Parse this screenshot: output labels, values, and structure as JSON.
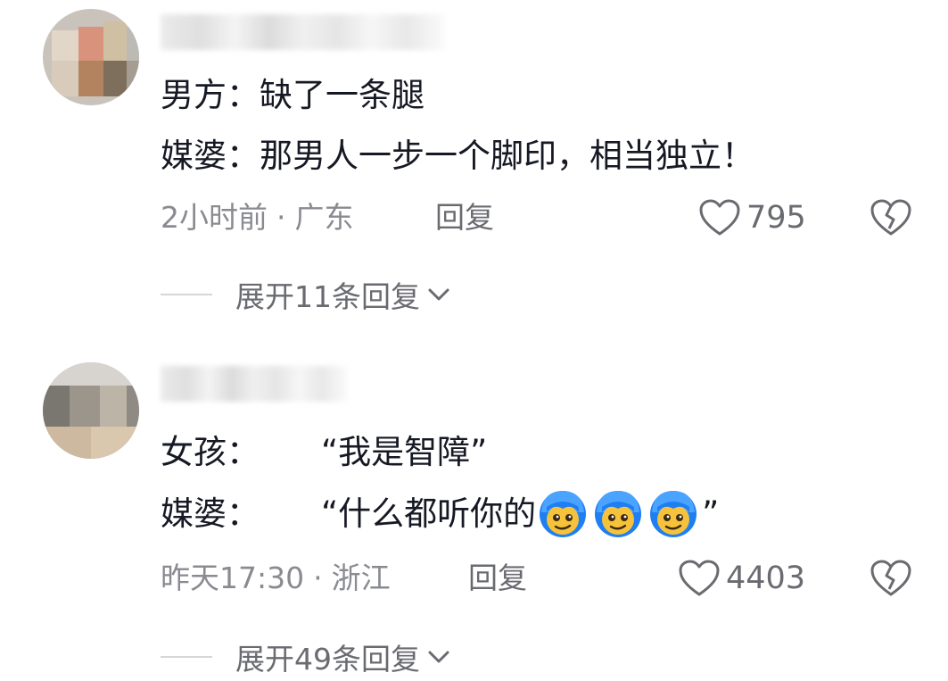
{
  "comments": [
    {
      "line1": {
        "label": "男方：",
        "text": "缺了一条腿"
      },
      "line2": {
        "label": "媒婆：",
        "text": "那男人一步一个脚印，相当独立！"
      },
      "meta": {
        "time": "2小时前",
        "location": "广东"
      },
      "reply_label": "回复",
      "likes": "795",
      "expand_label": "展开11条回复"
    },
    {
      "line1": {
        "label": "女孩：",
        "text": "“我是智障”"
      },
      "line2": {
        "label": "媒婆：",
        "text": "“什么都听你的",
        "suffix": "”"
      },
      "meta": {
        "time": "昨天17:30",
        "location": "浙江"
      },
      "reply_label": "回复",
      "likes": "4403",
      "expand_label": "展开49条回复"
    }
  ],
  "meta_separator": "·",
  "emoji_count": 3,
  "colors": {
    "text": "#161823",
    "meta": "#8a8b91",
    "action": "#6a6b70",
    "emoji_hair": "#1f7ef2",
    "emoji_face": "#f7c23b"
  },
  "icons": [
    "heart-outline-icon",
    "broken-heart-icon",
    "chevron-down-icon",
    "smirk-emoji-icon"
  ]
}
